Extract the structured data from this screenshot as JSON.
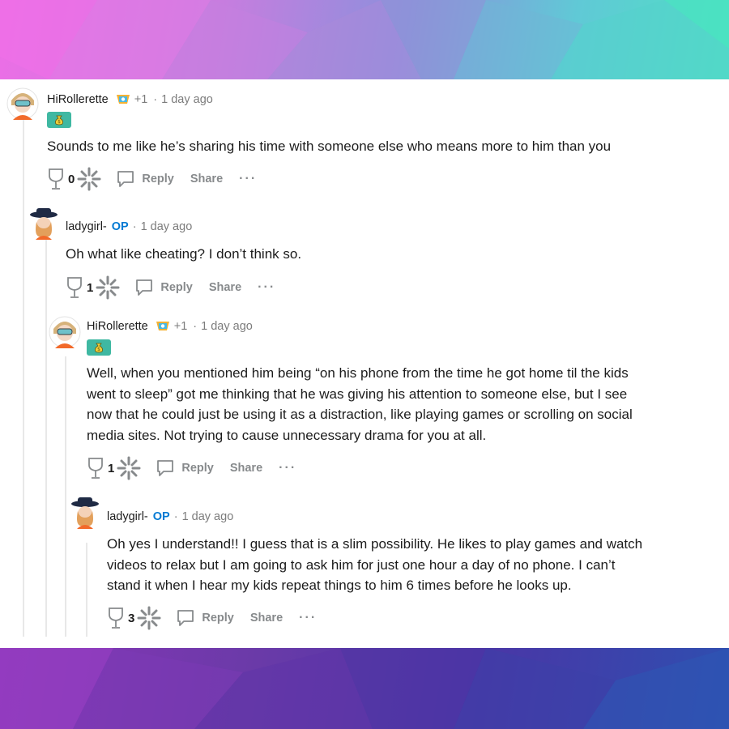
{
  "comments": [
    {
      "author": "HiRollerette",
      "karma": "+1",
      "sep": "·",
      "time": "1 day ago",
      "body": "Sounds to me like he’s sharing his time with someone else who means more to him than you",
      "votes": "0",
      "reply": "Reply",
      "share": "Share",
      "more": "···"
    },
    {
      "author": "ladygirl-",
      "op": "OP",
      "sep": "·",
      "time": "1 day ago",
      "body": "Oh what like cheating? I don’t think so.",
      "votes": "1",
      "reply": "Reply",
      "share": "Share",
      "more": "···"
    },
    {
      "author": "HiRollerette",
      "karma": "+1",
      "sep": "·",
      "time": "1 day ago",
      "body_lines": [
        "Well, when you mentioned him being “on his phone from the time he got home til the kids",
        "went to sleep” got me thinking that he was giving his attention to someone else, but I see",
        "now that he could just be using it as a distraction, like playing games or scrolling on social",
        "media sites. Not trying to cause unnecessary drama for you at all."
      ],
      "votes": "1",
      "reply": "Reply",
      "share": "Share",
      "more": "···"
    },
    {
      "author": "ladygirl-",
      "op": "OP",
      "sep": "·",
      "time": "1 day ago",
      "body_lines": [
        "Oh yes I understand!! I guess that is a slim possibility. He likes to play games and watch",
        "videos to relax but I am going to ask him for just one hour a day of no phone. I can’t",
        "stand it when I hear my kids repeat things to him 6 times before he looks up."
      ],
      "votes": "3",
      "reply": "Reply",
      "share": "Share",
      "more": "···"
    }
  ],
  "colors": {
    "op": "#0079d3",
    "flair": "#3fb8a2",
    "action_grey": "#878a8c",
    "thread_line": "#e8e8e8"
  },
  "icons": [
    "upvote-icon",
    "downvote-icon",
    "reply-bubble-icon",
    "achievement-icon",
    "money-bag-icon",
    "avatar-hirollerette",
    "avatar-ladygirl"
  ]
}
